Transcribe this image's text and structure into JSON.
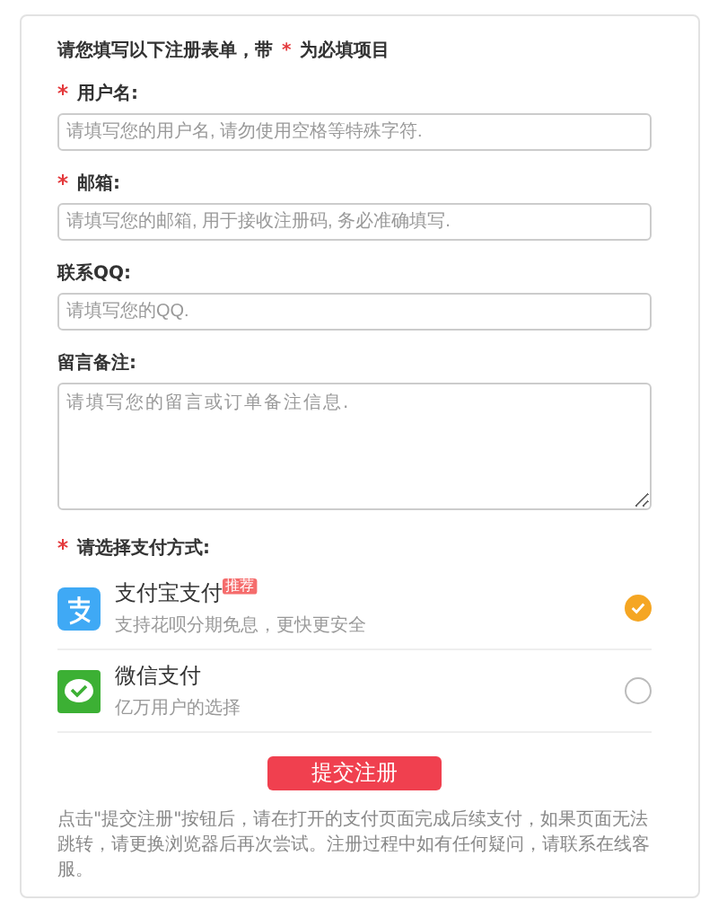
{
  "intro": {
    "before": "请您填写以下注册表单，带",
    "mark": "*",
    "after": "为必填项目"
  },
  "fields": [
    {
      "kind": "input",
      "label": "用户名:",
      "required": true,
      "placeholder": "请填写您的用户名, 请勿使用空格等特殊字符."
    },
    {
      "kind": "input",
      "label": "邮箱:",
      "required": true,
      "placeholder": "请填写您的邮箱, 用于接收注册码, 务必准确填写."
    },
    {
      "kind": "input",
      "label": "联系QQ:",
      "required": false,
      "placeholder": "请填写您的QQ."
    },
    {
      "kind": "textarea",
      "label": "留言备注:",
      "required": false,
      "placeholder": "请填写您的留言或订单备注信息."
    }
  ],
  "payment": {
    "label": "请选择支付方式:",
    "required": true,
    "methods": [
      {
        "kind": "alipay",
        "name": "支付宝支付",
        "badge": "推荐",
        "description": "支持花呗分期免息，更快更安全",
        "selected": true
      },
      {
        "kind": "wechat",
        "name": "微信支付",
        "description": "亿万用户的选择",
        "selected": false
      }
    ]
  },
  "submit": "提交注册",
  "note": "点击\"提交注册\"按钮后，请在打开的支付页面完成后续支付，如果页面无法跳转，请更换浏览器后再次尝试。注册过程中如有任何疑问，请联系在线客服。"
}
